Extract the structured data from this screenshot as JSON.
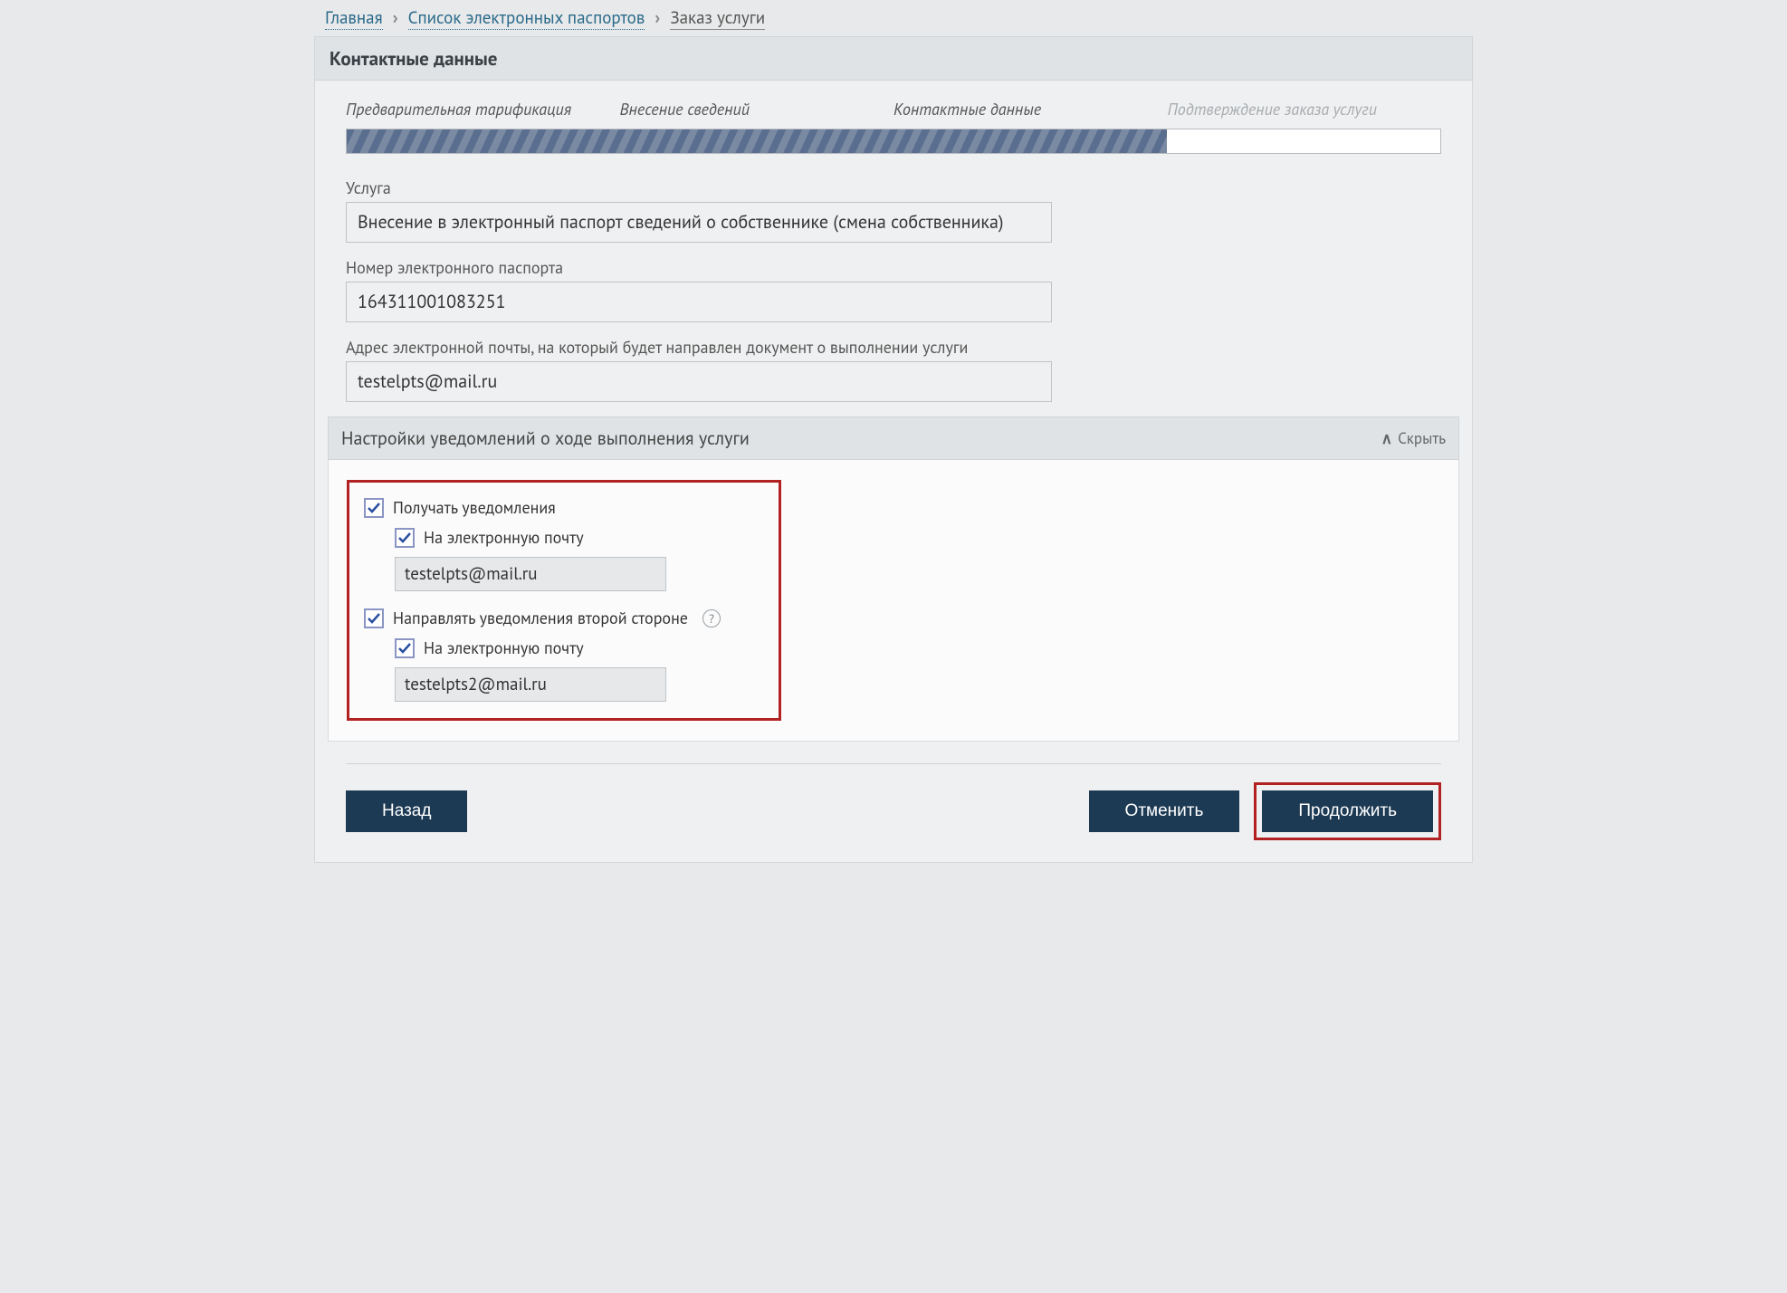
{
  "breadcrumb": {
    "home": "Главная",
    "list": "Список электронных паспортов",
    "current": "Заказ услуги"
  },
  "panel_title": "Контактные данные",
  "steps": {
    "s1": "Предварительная тарификация",
    "s2": "Внесение сведений",
    "s3": "Контактные данные",
    "s4": "Подтверждение заказа услуги"
  },
  "progress_percent": 75,
  "fields": {
    "service": {
      "label": "Услуга",
      "value": "Внесение в электронный паспорт сведений о собственнике (смена собственника)"
    },
    "passport_no": {
      "label": "Номер электронного паспорта",
      "value": "164311001083251"
    },
    "email": {
      "label": "Адрес электронной почты, на который будет направлен документ о выполнении услуги",
      "value": "testelpts@mail.ru"
    }
  },
  "notifications": {
    "title": "Настройки уведомлений о ходе выполнения услуги",
    "hide": "Скрыть",
    "receive_label": "Получать уведомления",
    "by_email_label": "На электронную почту",
    "email1": "testelpts@mail.ru",
    "second_party_label": "Направлять уведомления второй стороне",
    "email2": "testelpts2@mail.ru"
  },
  "buttons": {
    "back": "Назад",
    "cancel": "Отменить",
    "continue": "Продолжить"
  }
}
